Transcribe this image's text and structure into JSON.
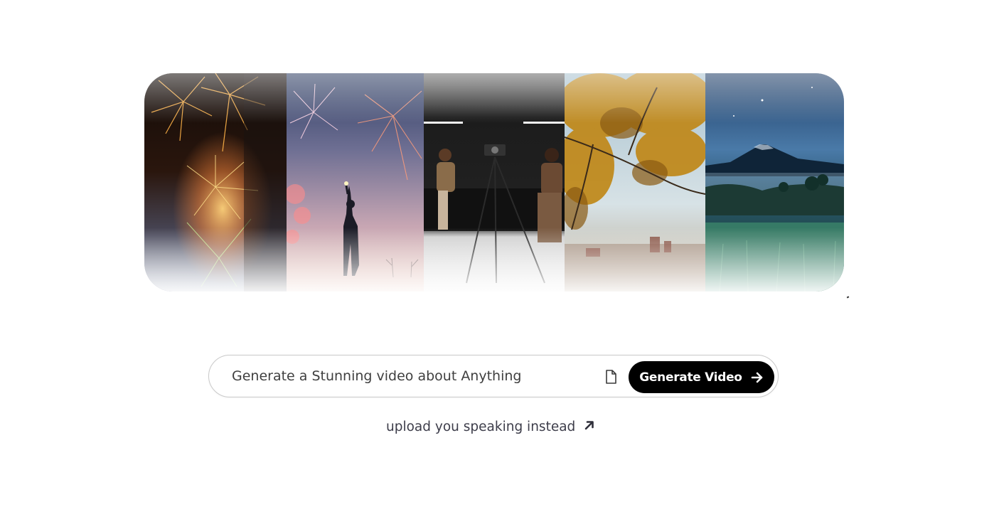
{
  "gallery": {
    "tiles": [
      {
        "icon": "fireworks-image"
      },
      {
        "icon": "person-fireworks-image"
      },
      {
        "icon": "podcast-studio-image"
      },
      {
        "icon": "autumn-tree-image"
      },
      {
        "icon": "mountain-night-image"
      }
    ]
  },
  "prompt": {
    "placeholder": "Generate a Stunning video about Anything",
    "value": "",
    "file_icon": "file-icon",
    "button_label": "Generate Video",
    "button_icon": "arrow-right-icon"
  },
  "upload": {
    "label": "upload you speaking instead",
    "icon": "arrow-up-right-icon"
  },
  "colors": {
    "button_bg": "#000000",
    "button_text": "#ffffff",
    "border": "#c9c9c9",
    "text": "#3d3d4a"
  }
}
